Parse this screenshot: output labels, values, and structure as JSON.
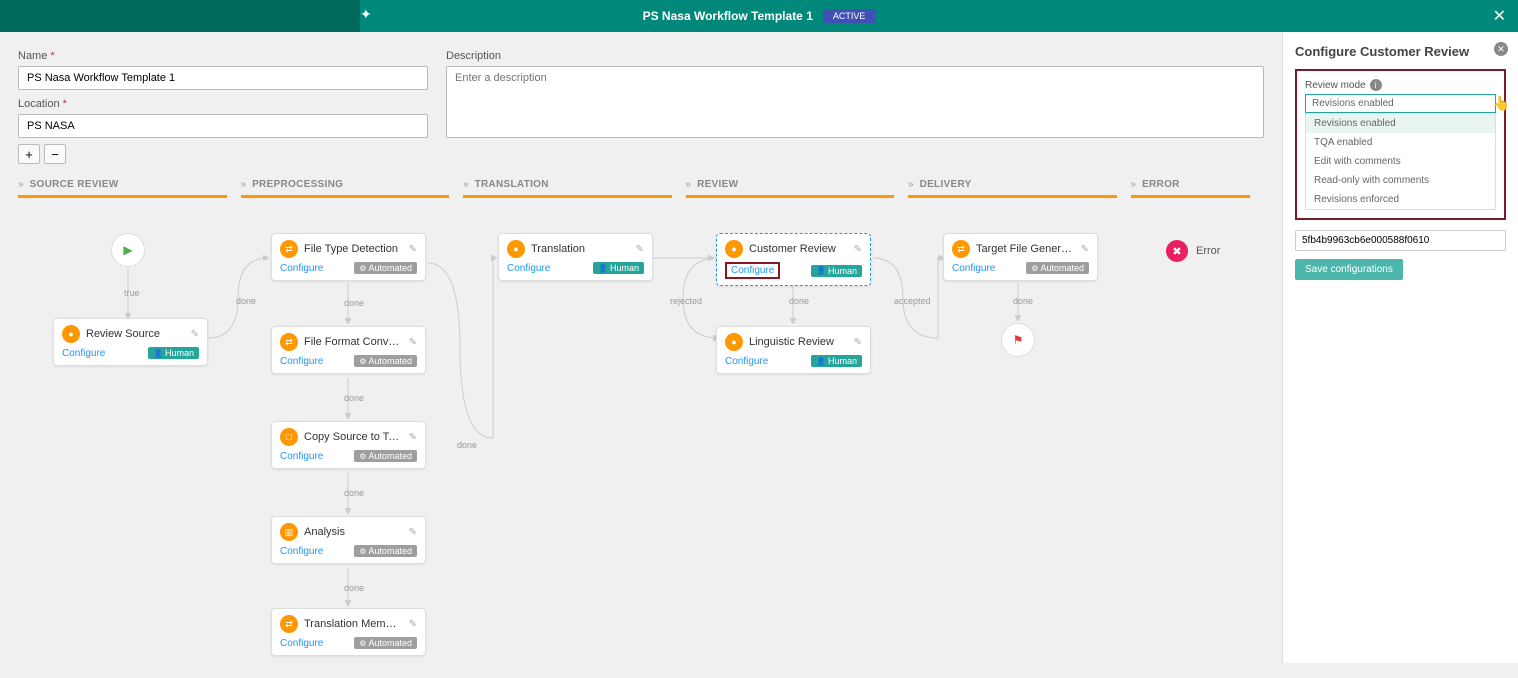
{
  "header": {
    "title": "PS Nasa Workflow Template 1",
    "status": "ACTIVE"
  },
  "form": {
    "name_label": "Name",
    "name_value": "PS Nasa Workflow Template 1",
    "location_label": "Location",
    "location_value": "PS NASA",
    "desc_label": "Description",
    "desc_placeholder": "Enter a description",
    "add": "+",
    "remove": "−"
  },
  "lanes": [
    "SOURCE REVIEW",
    "PREPROCESSING",
    "TRANSLATION",
    "REVIEW",
    "DELIVERY",
    "ERROR"
  ],
  "nodes": {
    "review_source": {
      "title": "Review Source",
      "configure": "Configure",
      "tag": "Human"
    },
    "file_type": {
      "title": "File Type Detection",
      "configure": "Configure",
      "tag": "Automated"
    },
    "file_format": {
      "title": "File Format Conversion",
      "configure": "Configure",
      "tag": "Automated"
    },
    "copy_source": {
      "title": "Copy Source to Target",
      "configure": "Configure",
      "tag": "Automated"
    },
    "analysis": {
      "title": "Analysis",
      "configure": "Configure",
      "tag": "Automated"
    },
    "tm_match": {
      "title": "Translation Memory Mat...",
      "configure": "Configure",
      "tag": "Automated"
    },
    "translation": {
      "title": "Translation",
      "configure": "Configure",
      "tag": "Human"
    },
    "customer_review": {
      "title": "Customer Review",
      "configure": "Configure",
      "tag": "Human"
    },
    "linguistic": {
      "title": "Linguistic Review",
      "configure": "Configure",
      "tag": "Human"
    },
    "target_gen": {
      "title": "Target File Generation",
      "configure": "Configure",
      "tag": "Automated"
    },
    "error": {
      "title": "Error"
    }
  },
  "edges": {
    "true": "true",
    "done": "done",
    "rejected": "rejected",
    "accepted": "accepted"
  },
  "panel": {
    "title": "Configure Customer Review",
    "review_mode_label": "Review mode",
    "selected": "Revisions enabled",
    "options": [
      "Revisions enabled",
      "TQA enabled",
      "Edit with comments",
      "Read-only with comments",
      "Revisions enforced"
    ],
    "id_value": "5fb4b9963cb6e000588f0610",
    "save": "Save configurations"
  }
}
